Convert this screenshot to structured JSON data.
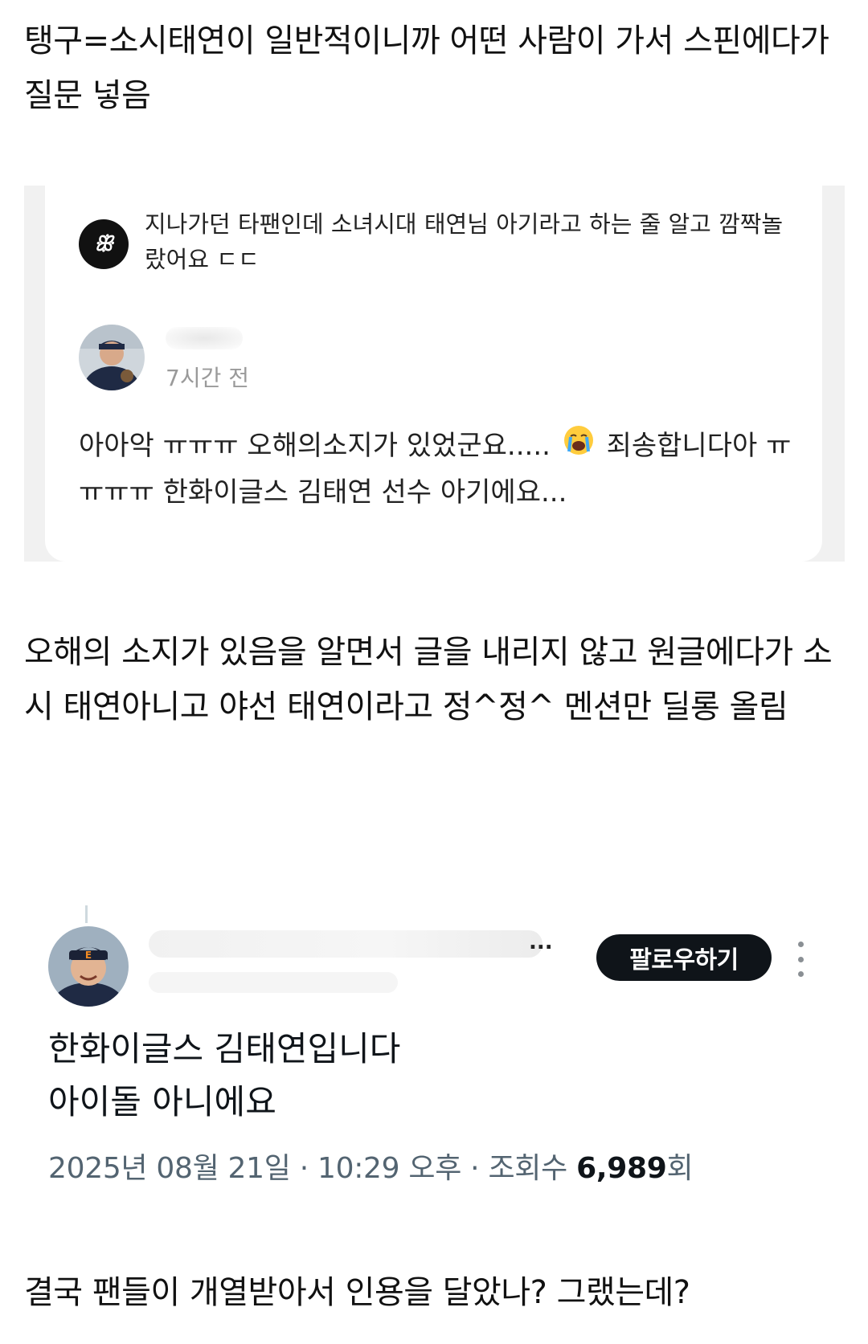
{
  "paragraphs": {
    "intro": "탱구=소시태연이 일반적이니까 어떤 사람이 가서 스핀에다가 질문 넣음",
    "middle": "오해의 소지가 있음을 알면서 글을 내리지 않고 원글에다가 소시 태연아니고 야선 태연이라고 정^정^ 멘션만 딜롱 올림",
    "closing": "결국 팬들이 개열받아서 인용을 달았나? 그랬는데?"
  },
  "qa_card": {
    "question": "지나가던 타팬인데 소녀시대 태연님 아기라고 하는 줄 알고 깜짝놀랐어요 ㄷㄷ",
    "answer_time": "7시간 전",
    "answer_part1": "아아악 ㅠㅠㅠ 오해의소지가 있었군요.....",
    "answer_emoji": "loudly-crying-face",
    "answer_part2": "죄송합니다아 ㅠㅠㅠㅠ 한화이글스 김태연 선수 아기에요..."
  },
  "tweet": {
    "name_suffix": "...",
    "follow_label": "팔로우하기",
    "line1": "한화이글스 김태연입니다",
    "line2": "아이돌 아니에요",
    "meta_prefix": "2025년 08월 21일 · 10:29 오후 · 조회수 ",
    "views": "6,989",
    "views_suffix": "회"
  },
  "icons": {
    "question_badge": "spin-logo-icon",
    "more": "more-vertical-icon"
  },
  "colors": {
    "follow_button": "#0f1419",
    "meta_text": "#536471",
    "card_background": "#f1f1f1"
  }
}
